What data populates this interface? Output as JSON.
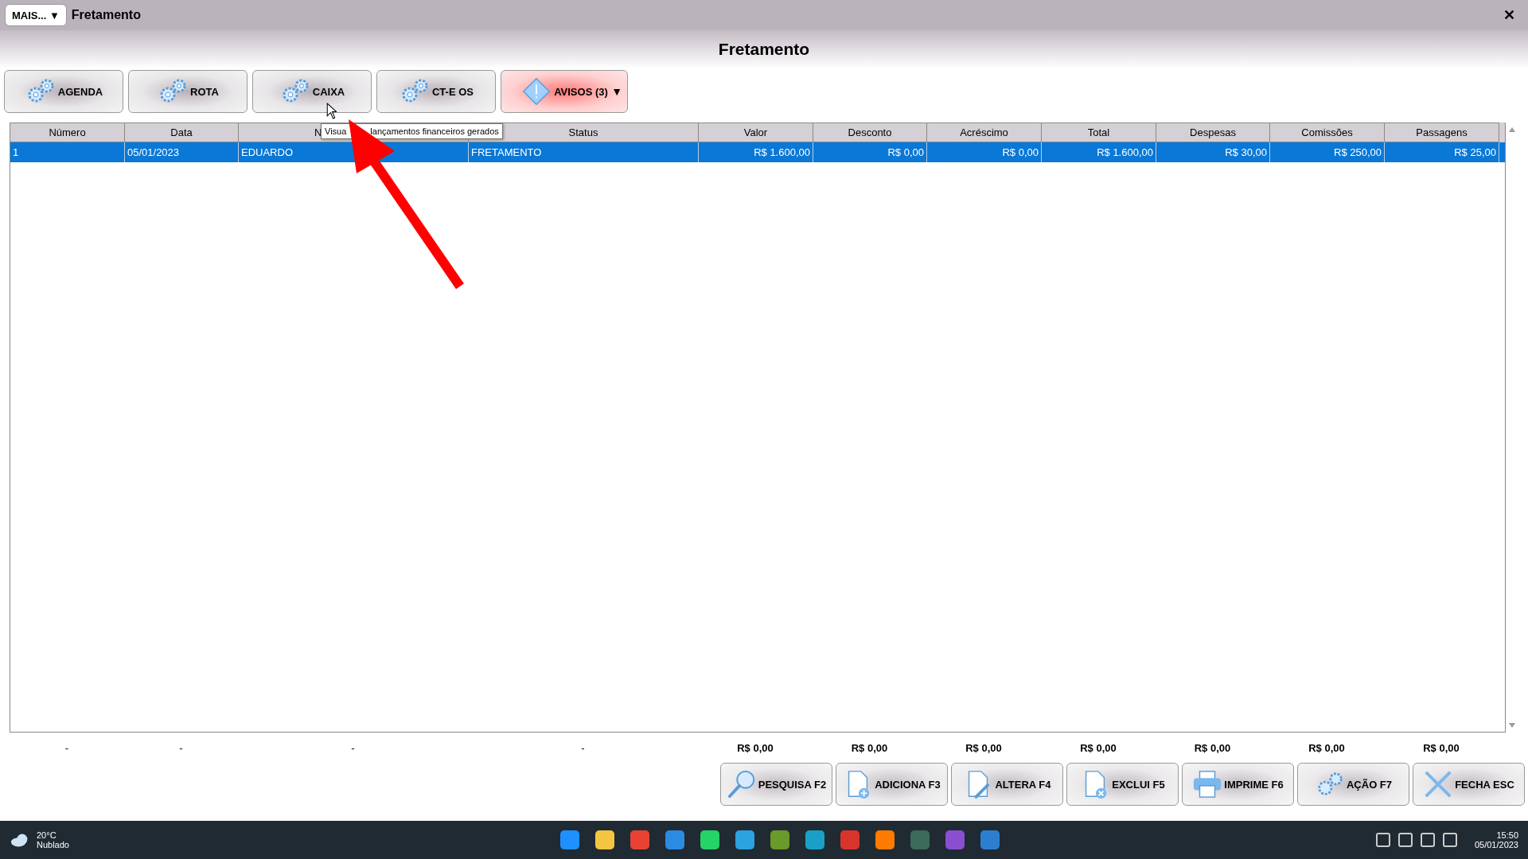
{
  "title_bar": {
    "menu_button": "MAIS...",
    "menu_caret": "▼",
    "title": "Fretamento",
    "close": "✕"
  },
  "page_title": "Fretamento",
  "toolbar": [
    {
      "label": "AGENDA",
      "kind": "gear"
    },
    {
      "label": "ROTA",
      "kind": "gear"
    },
    {
      "label": "CAIXA",
      "kind": "gear"
    },
    {
      "label": "CT-E OS",
      "kind": "gear"
    },
    {
      "label": "AVISOS (3)",
      "kind": "warning",
      "caret": "▼"
    }
  ],
  "tooltip": {
    "text_start": "Visua",
    "text_end": "lançamentos financeiros gerados"
  },
  "table": {
    "columns": [
      "Número",
      "Data",
      "N",
      "Status",
      "Valor",
      "Desconto",
      "Acréscimo",
      "Total",
      "Despesas",
      "Comissões",
      "Passagens"
    ],
    "rows": [
      {
        "selected": true,
        "cells": [
          "1",
          "05/01/2023",
          "EDUARDO",
          "FRETAMENTO",
          "R$ 1.600,00",
          "R$ 0,00",
          "R$ 0,00",
          "R$ 1.600,00",
          "R$ 30,00",
          "R$ 250,00",
          "R$ 25,00"
        ]
      }
    ]
  },
  "totals": [
    "-",
    "-",
    "-",
    "-",
    "R$ 0,00",
    "R$ 0,00",
    "R$ 0,00",
    "R$ 0,00",
    "R$ 0,00",
    "R$ 0,00",
    "R$ 0,00"
  ],
  "footer_buttons": [
    {
      "label": "PESQUISA F2",
      "kind": "search"
    },
    {
      "label": "ADICIONA F3",
      "kind": "add"
    },
    {
      "label": "ALTERA F4",
      "kind": "edit"
    },
    {
      "label": "EXCLUI F5",
      "kind": "delete"
    },
    {
      "label": "IMPRIME F6",
      "kind": "print"
    },
    {
      "label": "AÇÃO F7",
      "kind": "gear"
    },
    {
      "label": "FECHA ESC",
      "kind": "close"
    }
  ],
  "taskbar": {
    "temperature": "20°C",
    "weather": "Nublado",
    "time": "15:50",
    "date": "05/01/2023"
  }
}
